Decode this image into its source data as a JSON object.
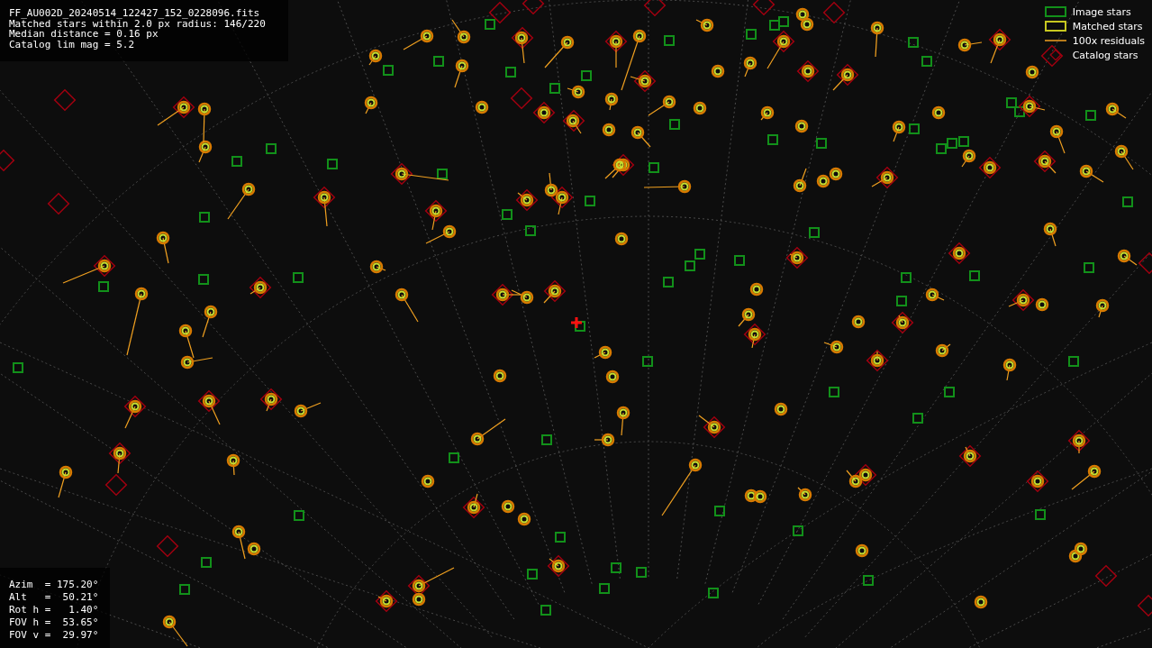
{
  "info_lines": [
    "FF_AU002D_20240514_122427_152_0228096.fits",
    "Matched stars within 2.0 px radius: 146/220",
    "Median distance = 0.16 px",
    "Catalog lim mag = 5.2"
  ],
  "legend": [
    {
      "kind": "image",
      "label": "Image stars"
    },
    {
      "kind": "matched",
      "label": "Matched stars"
    },
    {
      "kind": "residual",
      "label": "100x residuals"
    },
    {
      "kind": "catalog",
      "label": "Catalog stars"
    }
  ],
  "pointing_lines": [
    "Azim  = 175.20°",
    "Alt   =  50.21°",
    "Rot h =   1.40°",
    "FOV h =  53.65°",
    "FOV v =  29.97°"
  ]
}
